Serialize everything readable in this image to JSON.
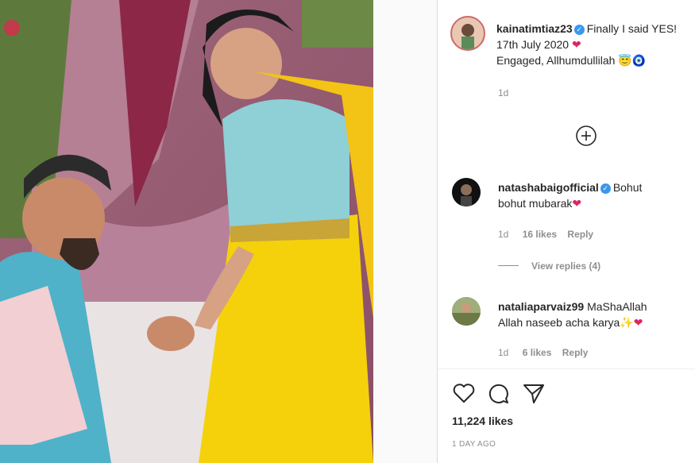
{
  "post": {
    "author": "kainatimtiaz23",
    "caption_line1": "Finally I said YES!",
    "caption_line2": "17th July 2020",
    "caption_line3": "Engaged, Allhumdullilah",
    "age": "1d",
    "emoji_smile": "😇",
    "emoji_eye": "🧿",
    "heart_emoji": "❤"
  },
  "load_more_icon": "plus-circle-icon",
  "comments": [
    {
      "user": "natashabaigofficial",
      "verified": true,
      "text_line1": "Bohut",
      "text_line2": "bohut mubarak",
      "heart": "❤",
      "age": "1d",
      "likes": "16 likes",
      "reply": "Reply",
      "view_replies": "View replies (4)"
    },
    {
      "user": "nataliaparvaiz99",
      "verified": false,
      "text_line1": "MaShaAllah",
      "text_line2": "Allah naseeb acha karya",
      "sparkle": "✨",
      "heart": "❤",
      "age": "1d",
      "likes": "6 likes",
      "reply": "Reply"
    }
  ],
  "actions": {
    "like_icon": "heart-icon",
    "comment_icon": "comment-icon",
    "share_icon": "send-icon"
  },
  "likes_count": "11,224 likes",
  "timestamp": "1 DAY AGO"
}
